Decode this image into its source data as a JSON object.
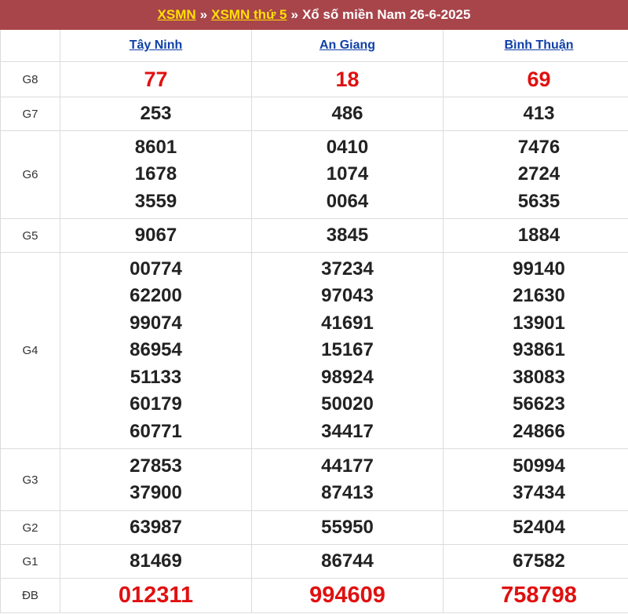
{
  "header": {
    "link1": "XSMN",
    "sep1": "»",
    "link2": "XSMN thứ 5",
    "sep2": "»",
    "title": "Xổ số miền Nam 26-6-2025"
  },
  "provinces": [
    "Tây Ninh",
    "An Giang",
    "Bình Thuận"
  ],
  "colors": {
    "header_bg": "#a8454b",
    "link_yellow": "#ffe000",
    "link_blue": "#1040a8",
    "highlight_red": "#e01010"
  },
  "prizes": [
    {
      "label": "G8",
      "values": [
        [
          "77"
        ],
        [
          "18"
        ],
        [
          "69"
        ]
      ]
    },
    {
      "label": "G7",
      "values": [
        [
          "253"
        ],
        [
          "486"
        ],
        [
          "413"
        ]
      ]
    },
    {
      "label": "G6",
      "values": [
        [
          "8601",
          "1678",
          "3559"
        ],
        [
          "0410",
          "1074",
          "0064"
        ],
        [
          "7476",
          "2724",
          "5635"
        ]
      ]
    },
    {
      "label": "G5",
      "values": [
        [
          "9067"
        ],
        [
          "3845"
        ],
        [
          "1884"
        ]
      ]
    },
    {
      "label": "G4",
      "values": [
        [
          "00774",
          "62200",
          "99074",
          "86954",
          "51133",
          "60179",
          "60771"
        ],
        [
          "37234",
          "97043",
          "41691",
          "15167",
          "98924",
          "50020",
          "34417"
        ],
        [
          "99140",
          "21630",
          "13901",
          "93861",
          "38083",
          "56623",
          "24866"
        ]
      ]
    },
    {
      "label": "G3",
      "values": [
        [
          "27853",
          "37900"
        ],
        [
          "44177",
          "87413"
        ],
        [
          "50994",
          "37434"
        ]
      ]
    },
    {
      "label": "G2",
      "values": [
        [
          "63987"
        ],
        [
          "55950"
        ],
        [
          "52404"
        ]
      ]
    },
    {
      "label": "G1",
      "values": [
        [
          "81469"
        ],
        [
          "86744"
        ],
        [
          "67582"
        ]
      ]
    },
    {
      "label": "ĐB",
      "values": [
        [
          "012311"
        ],
        [
          "994609"
        ],
        [
          "758798"
        ]
      ]
    }
  ]
}
